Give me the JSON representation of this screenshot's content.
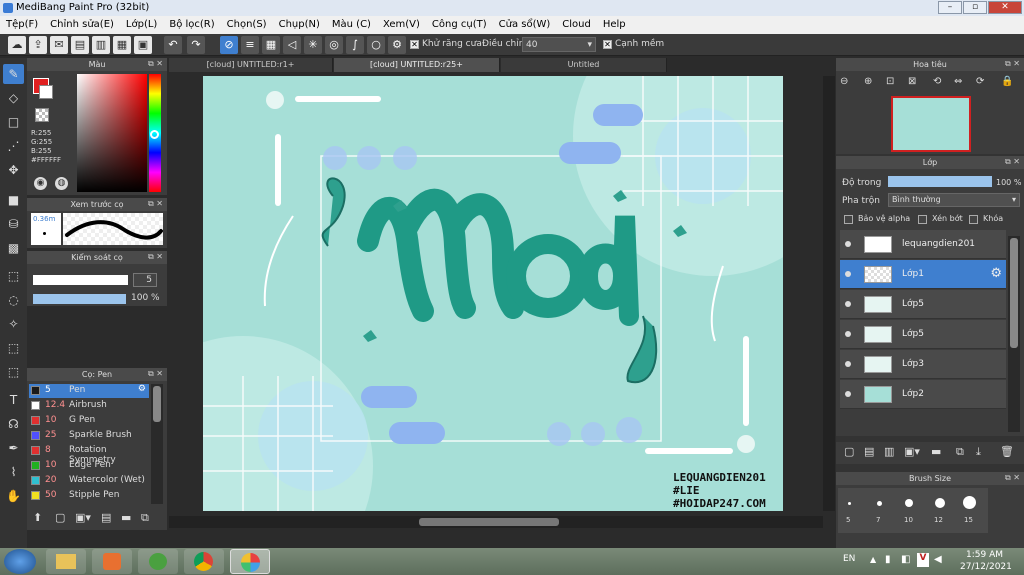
{
  "window": {
    "title": "MediBang Paint Pro (32bit)"
  },
  "menu": [
    "Tệp(F)",
    "Chỉnh sửa(E)",
    "Lớp(L)",
    "Bộ lọc(R)",
    "Chọn(S)",
    "Chụp(N)",
    "Màu (C)",
    "Xem(V)",
    "Công cụ(T)",
    "Cửa sổ(W)",
    "Cloud",
    "Help"
  ],
  "toolbar": {
    "antialias_label": "Khử răng cưa",
    "adjust_label": "Điều chỉnh",
    "adjust_value": "40",
    "edge_label": "Cạnh mềm"
  },
  "color_panel": {
    "title": "Màu",
    "r": "R:255",
    "g": "G:255",
    "b": "B:255",
    "hex": "#FFFFFF"
  },
  "preview_panel": {
    "title": "Xem trước cọ",
    "size": "0.36m"
  },
  "brush_control": {
    "title": "Kiểm soát cọ",
    "size_value": "5",
    "opacity_value": "100 %"
  },
  "brush_panel": {
    "title": "Cọ: Pen",
    "items": [
      {
        "size": "5",
        "name": "Pen",
        "color": "#1a1a1a",
        "selected": true
      },
      {
        "size": "12.4",
        "name": "Airbrush",
        "color": "#ffffff"
      },
      {
        "size": "10",
        "name": "G Pen",
        "color": "#e03030"
      },
      {
        "size": "25",
        "name": "Sparkle Brush",
        "color": "#5050ff"
      },
      {
        "size": "8",
        "name": "Rotation Symmetry",
        "color": "#e03030"
      },
      {
        "size": "10",
        "name": "Edge Pen",
        "color": "#20b020"
      },
      {
        "size": "20",
        "name": "Watercolor (Wet)",
        "color": "#30c0d0"
      },
      {
        "size": "50",
        "name": "Stipple Pen",
        "color": "#f0e020"
      }
    ]
  },
  "tabs": [
    "[cloud] UNTITLED:r1+",
    "[cloud] UNTITLED:r25+",
    "Untitled"
  ],
  "artwork": {
    "title": "Mod",
    "credit1": "LEQUANGDIEN201",
    "credit2": "#LIE",
    "credit3": "#HOIDAP247.COM"
  },
  "navigator": {
    "title": "Hoa tiêu"
  },
  "layer_panel": {
    "title": "Lớp",
    "opacity_label": "Độ trong",
    "opacity_value": "100 %",
    "blend_label": "Pha trộn",
    "blend_value": "Bình thường",
    "alpha_label": "Bảo vệ alpha",
    "clip_label": "Xén bớt",
    "lock_label": "Khóa",
    "layers": [
      {
        "name": "lequangdien201"
      },
      {
        "name": "Lớp1",
        "selected": true
      },
      {
        "name": "Lớp5"
      },
      {
        "name": "Lớp5"
      },
      {
        "name": "Lớp3"
      },
      {
        "name": "Lớp2"
      }
    ]
  },
  "brush_size_panel": {
    "title": "Brush Size",
    "sizes": [
      "5",
      "7",
      "10",
      "12",
      "15"
    ]
  },
  "taskbar": {
    "lang": "EN",
    "time": "1:59 AM",
    "date": "27/12/2021"
  }
}
